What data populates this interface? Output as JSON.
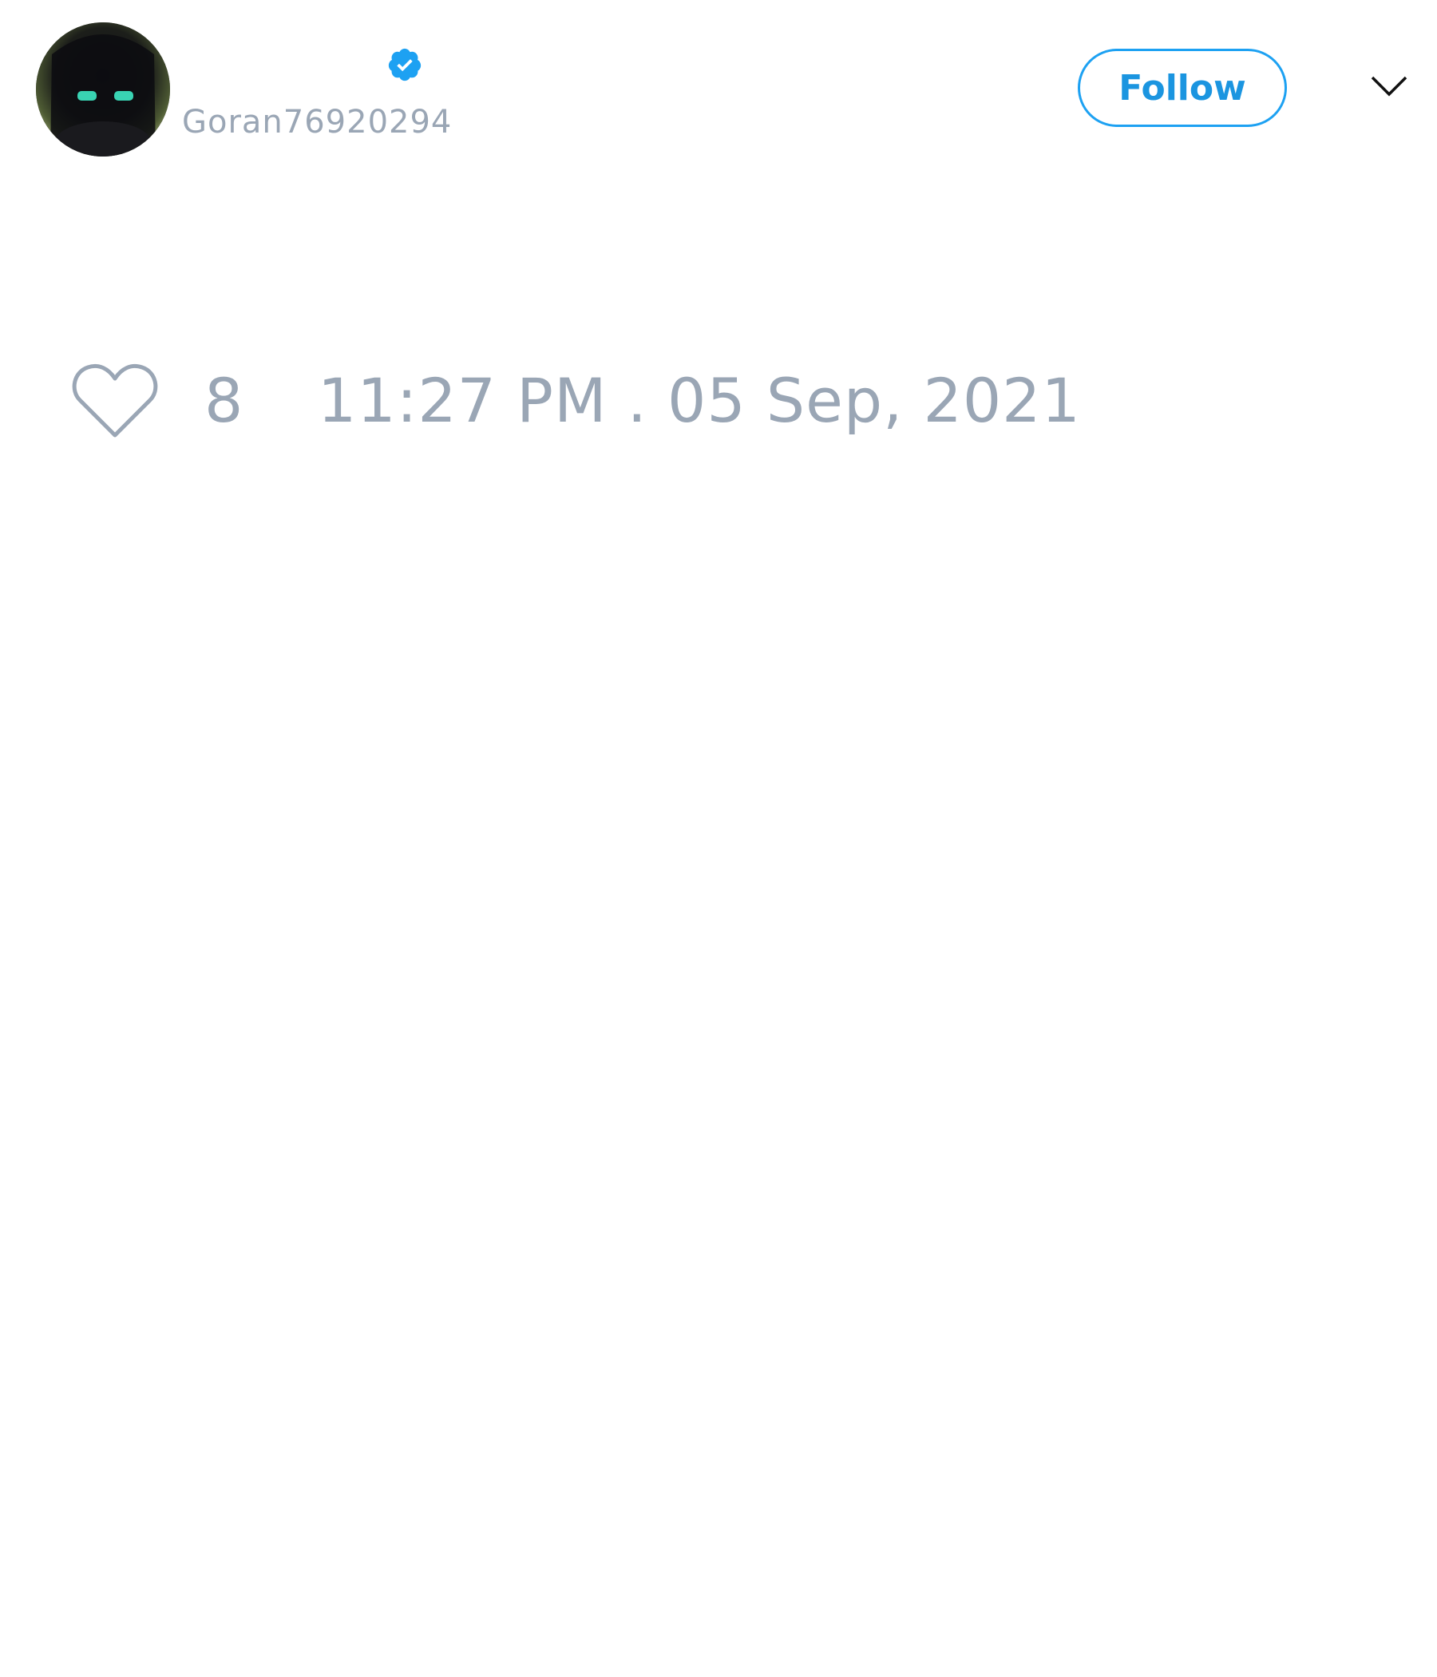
{
  "tweet": {
    "author": {
      "handle": "Goran76920294",
      "verified": true,
      "avatar_description": "profile-photo"
    },
    "follow_button": {
      "label": "Follow"
    },
    "menu": {
      "icon": "chevron-down-icon"
    },
    "like": {
      "icon": "heart-icon",
      "count": "8"
    },
    "timestamp": "11:27 PM . 05 Sep, 2021"
  },
  "colors": {
    "accent": "#1da1f2",
    "muted_text": "#9aa6b5",
    "background": "#ffffff"
  }
}
